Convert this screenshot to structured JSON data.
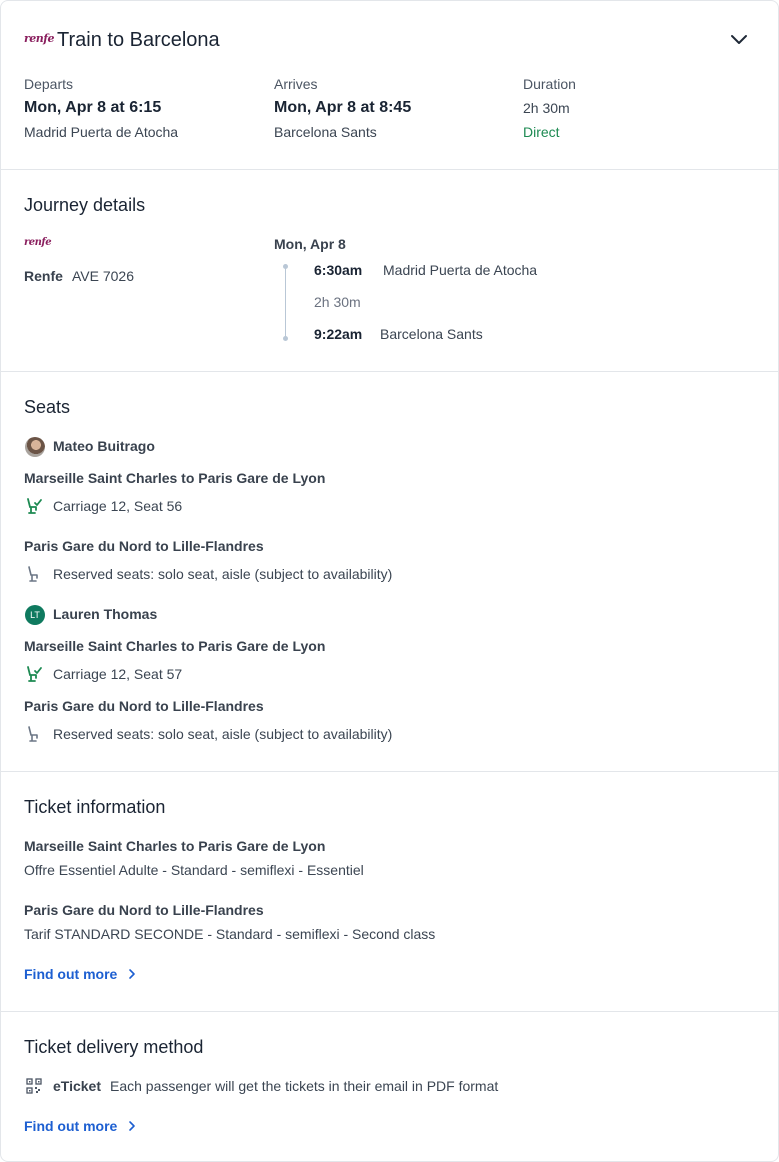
{
  "header": {
    "operator_logo": "renfe",
    "title": "Train to Barcelona",
    "departs": {
      "label": "Departs",
      "value": "Mon, Apr 8 at 6:15",
      "station": "Madrid Puerta de Atocha"
    },
    "arrives": {
      "label": "Arrives",
      "value": "Mon, Apr 8 at 8:45",
      "station": "Barcelona Sants"
    },
    "duration": {
      "label": "Duration",
      "value": "2h 30m",
      "type": "Direct"
    }
  },
  "journey": {
    "title": "Journey details",
    "operator_logo": "renfe",
    "operator": "Renfe",
    "train": "AVE 7026",
    "date": "Mon, Apr 8",
    "dep_time": "6:30am",
    "dep_station": "Madrid Puerta de Atocha",
    "duration": "2h 30m",
    "arr_time": "9:22am",
    "arr_station": "Barcelona Sants"
  },
  "seats": {
    "title": "Seats",
    "passengers": [
      {
        "name": "Mateo Buitrago",
        "segments": [
          {
            "route": "Marseille Saint Charles to Paris Gare de Lyon",
            "seat": "Carriage 12, Seat 56"
          },
          {
            "route": "Paris Gare du Nord to Lille-Flandres",
            "seat": "Reserved seats: solo seat, aisle (subject to availability)"
          }
        ]
      },
      {
        "name": "Lauren Thomas",
        "initials": "LT",
        "segments": [
          {
            "route": "Marseille Saint Charles to Paris Gare de Lyon",
            "seat": "Carriage 12, Seat 57"
          },
          {
            "route": "Paris Gare du Nord to Lille-Flandres",
            "seat": "Reserved seats: solo seat, aisle (subject to availability)"
          }
        ]
      }
    ]
  },
  "ticket_info": {
    "title": "Ticket information",
    "items": [
      {
        "route": "Marseille Saint Charles to Paris Gare de Lyon",
        "fare": "Offre Essentiel Adulte - Standard - semiflexi - Essentiel"
      },
      {
        "route": "Paris Gare du Nord to Lille-Flandres",
        "fare": "Tarif STANDARD SECONDE - Standard - semiflexi - Second class"
      }
    ],
    "link": "Find out more"
  },
  "delivery": {
    "title": "Ticket delivery method",
    "method": "eTicket",
    "description": "Each passenger will get the tickets in their email in PDF format",
    "link": "Find out more"
  },
  "colors": {
    "brand_renfe": "#8a1f5e",
    "success_green": "#1d8a52",
    "link_blue": "#1d5fd1",
    "avatar_teal": "#0f7a5f",
    "timeline": "#b9c7d6"
  },
  "icons": [
    "chevron-down-icon",
    "seat-confirmed-icon",
    "seat-reserved-icon",
    "qr-code-icon",
    "chevron-right-icon"
  ]
}
